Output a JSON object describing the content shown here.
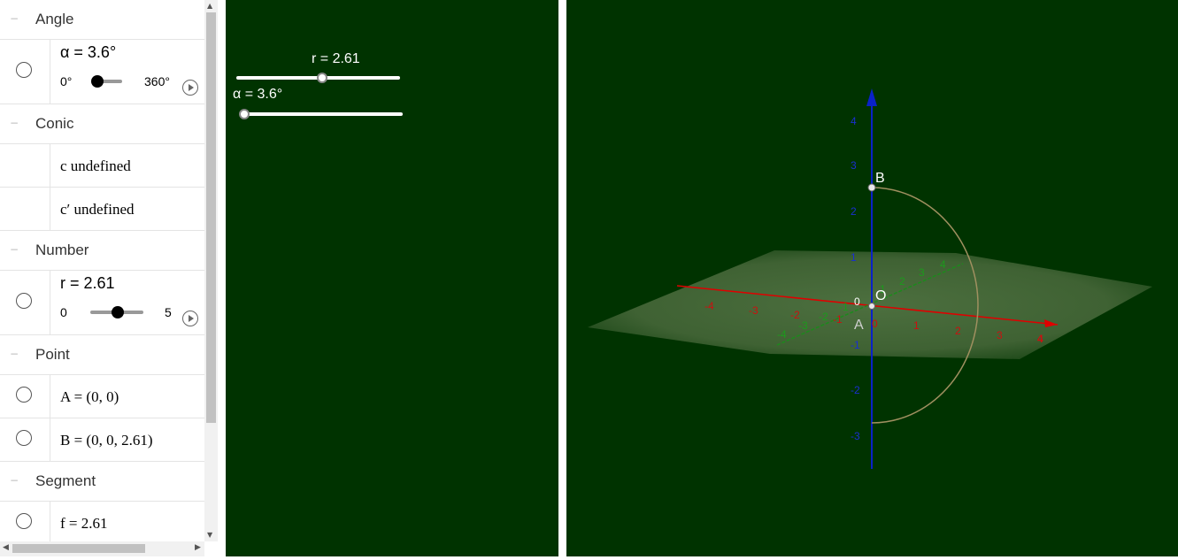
{
  "algebra": {
    "groups": {
      "angle": "Angle",
      "conic": "Conic",
      "number": "Number",
      "point": "Point",
      "segment": "Segment"
    },
    "alpha_slider": {
      "label": "α = 3.6°",
      "min": "0°",
      "max": "360°",
      "value_fraction": 0.01
    },
    "conic_c": "c undefined",
    "conic_c2": "c′ undefined",
    "r_slider": {
      "label": "r = 2.61",
      "min": "0",
      "max": "5",
      "value_fraction": 0.522
    },
    "point_a": "A = (0, 0)",
    "point_b": "B = (0, 0, 2.61)",
    "segment_f": "f = 2.61"
  },
  "graphics2d": {
    "r_slider_label": "r = 2.61",
    "r_fraction": 0.522,
    "alpha_slider_label": "α = 3.6°",
    "alpha_fraction": 0.01
  },
  "graphics3d": {
    "point_b": "B",
    "point_o": "O",
    "point_a": "A",
    "origin_label": "0",
    "z_ticks": [
      "4",
      "3",
      "2",
      "1",
      "-1",
      "-2",
      "-3"
    ],
    "x_ticks": [
      "-4",
      "-3",
      "-2",
      "-1",
      "0",
      "1",
      "2",
      "3",
      "4"
    ],
    "y_ticks": [
      "-4",
      "-3",
      "-2",
      "-1",
      "1",
      "2",
      "3",
      "4"
    ]
  },
  "colors": {
    "background": "#003300",
    "x_axis": "#e00000",
    "y_axis": "#1c8a1c",
    "z_axis": "#0a22c8"
  }
}
